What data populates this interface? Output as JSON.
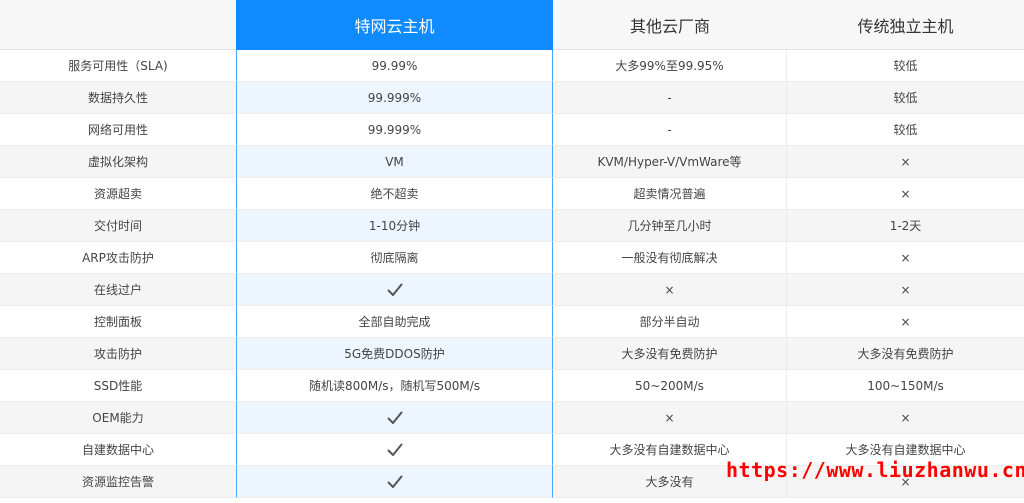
{
  "headers": [
    "",
    "特网云主机",
    "其他云厂商",
    "传统独立主机"
  ],
  "rows": [
    {
      "feature": "服务可用性（SLA)",
      "tewang": "99.99%",
      "other": "大多99%至99.95%",
      "traditional": "较低"
    },
    {
      "feature": "数据持久性",
      "tewang": "99.999%",
      "other": "-",
      "traditional": "较低"
    },
    {
      "feature": "网络可用性",
      "tewang": "99.999%",
      "other": "-",
      "traditional": "较低"
    },
    {
      "feature": "虚拟化架构",
      "tewang": "VM",
      "other": "KVM/Hyper-V/VmWare等",
      "traditional": "×"
    },
    {
      "feature": "资源超卖",
      "tewang": "绝不超卖",
      "other": "超卖情况普遍",
      "traditional": "×"
    },
    {
      "feature": "交付时间",
      "tewang": "1-10分钟",
      "other": "几分钟至几小时",
      "traditional": "1-2天"
    },
    {
      "feature": "ARP攻击防护",
      "tewang": "彻底隔离",
      "other": "一般没有彻底解决",
      "traditional": "×"
    },
    {
      "feature": "在线过户",
      "tewang": "✓",
      "other": "×",
      "traditional": "×"
    },
    {
      "feature": "控制面板",
      "tewang": "全部自助完成",
      "other": "部分半自动",
      "traditional": "×"
    },
    {
      "feature": "攻击防护",
      "tewang": "5G免费DDOS防护",
      "other": "大多没有免费防护",
      "traditional": "大多没有免费防护"
    },
    {
      "feature": "SSD性能",
      "tewang": "随机读800M/s，随机写500M/s",
      "other": "50~200M/s",
      "traditional": "100~150M/s"
    },
    {
      "feature": "OEM能力",
      "tewang": "✓",
      "other": "×",
      "traditional": "×"
    },
    {
      "feature": "自建数据中心",
      "tewang": "✓",
      "other": "大多没有自建数据中心",
      "traditional": "大多没有自建数据中心"
    },
    {
      "feature": "资源监控告警",
      "tewang": "✓",
      "other": "大多没有",
      "traditional": "×"
    }
  ],
  "watermark": "https://www.liuzhanwu.cn",
  "colors": {
    "accent": "#0f8bff",
    "watermark": "#ff0000"
  }
}
